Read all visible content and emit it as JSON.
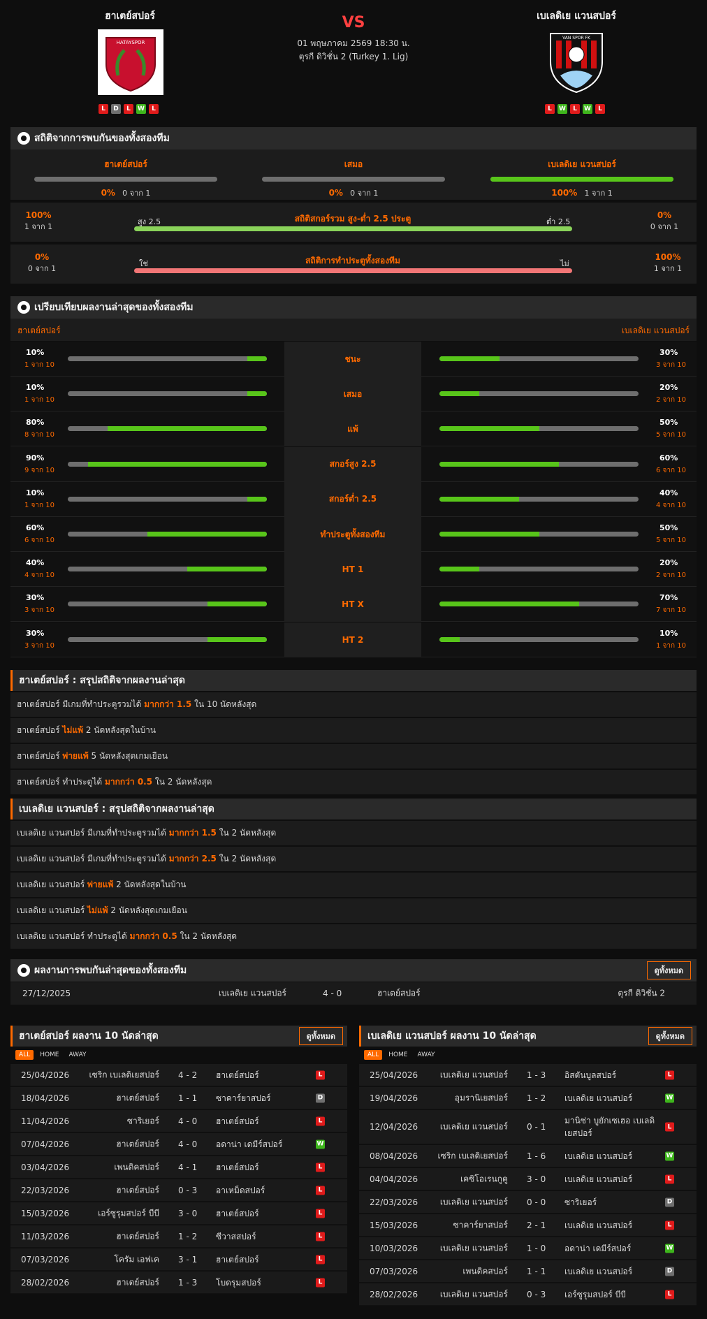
{
  "header": {
    "home": "ฮาเตย์สปอร์",
    "away": "เบเลดิเย แวนสปอร์",
    "vs": "VS",
    "datetime": "01 พฤษภาคม 2569 18:30 น.",
    "league": "ตุรกี ดิวิชั่น 2 (Turkey 1. Lig)",
    "home_logo_text": "HATAYSPOR",
    "away_logo_text": "VAN SPOR FK",
    "home_form": [
      "L",
      "D",
      "L",
      "W",
      "L"
    ],
    "away_form": [
      "L",
      "W",
      "L",
      "W",
      "L"
    ]
  },
  "h2h": {
    "title": "สถิติจากการพบกันของทั้งสองทีม",
    "home_label": "ฮาเตย์สปอร์",
    "draw_label": "เสมอ",
    "away_label": "เบเลดิเย แวนสปอร์",
    "home_pct": "0%",
    "home_of": "0 จาก 1",
    "draw_pct": "0%",
    "draw_of": "0 จาก 1",
    "away_pct": "100%",
    "away_of": "1 จาก 1",
    "home_fill": 0,
    "draw_fill": 0,
    "away_fill": 1
  },
  "ou": {
    "label": "สถิติสกอร์รวม สูง-ต่ำ 2.5 ประตู",
    "left_pct": "100%",
    "left_of": "1 จาก 1",
    "right_pct": "0%",
    "right_of": "0 จาก 1",
    "left_tag": "สูง 2.5",
    "right_tag": "ต่ำ 2.5"
  },
  "btts": {
    "label": "สถิติการทำประตูทั้งสองทีม",
    "left_pct": "0%",
    "left_of": "0 จาก 1",
    "right_pct": "100%",
    "right_of": "1 จาก 1",
    "left_tag": "ใช่",
    "right_tag": "ไม่"
  },
  "compare": {
    "title": "เปรียบเทียบผลงานล่าสุดของทั้งสองทีม",
    "home": "ฮาเตย์สปอร์",
    "away": "เบเลดิเย แวนสปอร์",
    "rows": [
      {
        "label": "ชนะ",
        "hp": "10%",
        "hof": "1 จาก 10",
        "hv": 0.1,
        "ap": "30%",
        "aof": "3 จาก 10",
        "av": 0.3
      },
      {
        "label": "เสมอ",
        "hp": "10%",
        "hof": "1 จาก 10",
        "hv": 0.1,
        "ap": "20%",
        "aof": "2 จาก 10",
        "av": 0.2
      },
      {
        "label": "แพ้",
        "hp": "80%",
        "hof": "8 จาก 10",
        "hv": 0.8,
        "ap": "50%",
        "aof": "5 จาก 10",
        "av": 0.5
      },
      {
        "label": "สกอร์สูง 2.5",
        "hp": "90%",
        "hof": "9 จาก 10",
        "hv": 0.9,
        "ap": "60%",
        "aof": "6 จาก 10",
        "av": 0.6
      },
      {
        "label": "สกอร์ต่ำ 2.5",
        "hp": "10%",
        "hof": "1 จาก 10",
        "hv": 0.1,
        "ap": "40%",
        "aof": "4 จาก 10",
        "av": 0.4
      },
      {
        "label": "ทำประตูทั้งสองทีม",
        "hp": "60%",
        "hof": "6 จาก 10",
        "hv": 0.6,
        "ap": "50%",
        "aof": "5 จาก 10",
        "av": 0.5
      },
      {
        "label": "HT 1",
        "hp": "40%",
        "hof": "4 จาก 10",
        "hv": 0.4,
        "ap": "20%",
        "aof": "2 จาก 10",
        "av": 0.2
      },
      {
        "label": "HT X",
        "hp": "30%",
        "hof": "3 จาก 10",
        "hv": 0.3,
        "ap": "70%",
        "aof": "7 จาก 10",
        "av": 0.7
      },
      {
        "label": "HT 2",
        "hp": "30%",
        "hof": "3 จาก 10",
        "hv": 0.3,
        "ap": "10%",
        "aof": "1 จาก 10",
        "av": 0.1
      }
    ]
  },
  "home_summary": {
    "title": "ฮาเตย์สปอร์ : สรุปสถิติจากผลงานล่าสุด",
    "rows": [
      [
        "ฮาเตย์สปอร์ มีเกมที่ทำประตูรวมได้ ",
        "มากกว่า 1.5",
        " ใน 10 นัดหลังสุด"
      ],
      [
        "ฮาเตย์สปอร์ ",
        "ไม่แพ้",
        " 2 นัดหลังสุดในบ้าน"
      ],
      [
        "ฮาเตย์สปอร์ ",
        "พ่ายแพ้",
        " 5 นัดหลังสุดเกมเยือน"
      ],
      [
        "ฮาเตย์สปอร์ ทำประตูได้ ",
        "มากกว่า 0.5",
        " ใน 2 นัดหลังสุด"
      ]
    ]
  },
  "away_summary": {
    "title": "เบเลดิเย แวนสปอร์ : สรุปสถิติจากผลงานล่าสุด",
    "rows": [
      [
        "เบเลดิเย แวนสปอร์ มีเกมที่ทำประตูรวมได้ ",
        "มากกว่า 1.5",
        " ใน 2 นัดหลังสุด"
      ],
      [
        "เบเลดิเย แวนสปอร์ มีเกมที่ทำประตูรวมได้ ",
        "มากกว่า 2.5",
        " ใน 2 นัดหลังสุด"
      ],
      [
        "เบเลดิเย แวนสปอร์ ",
        "พ่ายแพ้",
        " 2 นัดหลังสุดในบ้าน"
      ],
      [
        "เบเลดิเย แวนสปอร์ ",
        "ไม่แพ้",
        " 2 นัดหลังสุดเกมเยือน"
      ],
      [
        "เบเลดิเย แวนสปอร์ ทำประตูได้ ",
        "มากกว่า 0.5",
        " ใน 2 นัดหลังสุด"
      ]
    ]
  },
  "h2h_results": {
    "title": "ผลงานการพบกันล่าสุดของทั้งสองทีม",
    "button": "ดูทั้งหมด",
    "rows": [
      {
        "date": "27/12/2025",
        "home": "เบเลดิเย แวนสปอร์",
        "score": "4 - 0",
        "away": "ฮาเตย์สปอร์",
        "league": "ตุรกี ดิวิชั่น 2"
      }
    ]
  },
  "tabs": [
    "ALL",
    "HOME",
    "AWAY"
  ],
  "home_last": {
    "title": "ฮาเตย์สปอร์ ผลงาน 10 นัดล่าสุด",
    "button": "ดูทั้งหมด",
    "rows": [
      {
        "date": "25/04/2026",
        "home": "เซริก เบเลดิเยสปอร์",
        "score": "4 - 2",
        "away": "ฮาเตย์สปอร์",
        "r": "L"
      },
      {
        "date": "18/04/2026",
        "home": "ฮาเตย์สปอร์",
        "score": "1 - 1",
        "away": "ซาคาร์ยาสปอร์",
        "r": "D"
      },
      {
        "date": "11/04/2026",
        "home": "ซาริเยอร์",
        "score": "4 - 0",
        "away": "ฮาเตย์สปอร์",
        "r": "L"
      },
      {
        "date": "07/04/2026",
        "home": "ฮาเตย์สปอร์",
        "score": "4 - 0",
        "away": "อดาน่า เดมีร์สปอร์",
        "r": "W"
      },
      {
        "date": "03/04/2026",
        "home": "เพนดิคสปอร์",
        "score": "4 - 1",
        "away": "ฮาเตย์สปอร์",
        "r": "L"
      },
      {
        "date": "22/03/2026",
        "home": "ฮาเตย์สปอร์",
        "score": "0 - 3",
        "away": "อาเหม็ดสปอร์",
        "r": "L"
      },
      {
        "date": "15/03/2026",
        "home": "เอร์ซูรุมสปอร์ บีบี",
        "score": "3 - 0",
        "away": "ฮาเตย์สปอร์",
        "r": "L"
      },
      {
        "date": "11/03/2026",
        "home": "ฮาเตย์สปอร์",
        "score": "1 - 2",
        "away": "ซีวาสสปอร์",
        "r": "L"
      },
      {
        "date": "07/03/2026",
        "home": "โครัม เอฟเค",
        "score": "3 - 1",
        "away": "ฮาเตย์สปอร์",
        "r": "L"
      },
      {
        "date": "28/02/2026",
        "home": "ฮาเตย์สปอร์",
        "score": "1 - 3",
        "away": "โบดรุมสปอร์",
        "r": "L"
      }
    ]
  },
  "away_last": {
    "title": "เบเลดิเย แวนสปอร์ ผลงาน 10 นัดล่าสุด",
    "button": "ดูทั้งหมด",
    "rows": [
      {
        "date": "25/04/2026",
        "home": "เบเลดิเย แวนสปอร์",
        "score": "1 - 3",
        "away": "อิสตันบูลสปอร์",
        "r": "L"
      },
      {
        "date": "19/04/2026",
        "home": "อุมรานิเยสปอร์",
        "score": "1 - 2",
        "away": "เบเลดิเย แวนสปอร์",
        "r": "W"
      },
      {
        "date": "12/04/2026",
        "home": "เบเลดิเย แวนสปอร์",
        "score": "0 - 1",
        "away": "มานิซ่า บูยักเซเฮอ เบเลดิเยสปอร์",
        "r": "L"
      },
      {
        "date": "08/04/2026",
        "home": "เซริก เบเลดิเยสปอร์",
        "score": "1 - 6",
        "away": "เบเลดิเย แวนสปอร์",
        "r": "W"
      },
      {
        "date": "04/04/2026",
        "home": "เคซิโอเรนกูคู",
        "score": "3 - 0",
        "away": "เบเลดิเย แวนสปอร์",
        "r": "L"
      },
      {
        "date": "22/03/2026",
        "home": "เบเลดิเย แวนสปอร์",
        "score": "0 - 0",
        "away": "ซาริเยอร์",
        "r": "D"
      },
      {
        "date": "15/03/2026",
        "home": "ซาคาร์ยาสปอร์",
        "score": "2 - 1",
        "away": "เบเลดิเย แวนสปอร์",
        "r": "L"
      },
      {
        "date": "10/03/2026",
        "home": "เบเลดิเย แวนสปอร์",
        "score": "1 - 0",
        "away": "อดาน่า เดมีร์สปอร์",
        "r": "W"
      },
      {
        "date": "07/03/2026",
        "home": "เพนดิคสปอร์",
        "score": "1 - 1",
        "away": "เบเลดิเย แวนสปอร์",
        "r": "D"
      },
      {
        "date": "28/02/2026",
        "home": "เบเลดิเย แวนสปอร์",
        "score": "0 - 3",
        "away": "เอร์ซูรุมสปอร์ บีบี",
        "r": "L"
      }
    ]
  }
}
